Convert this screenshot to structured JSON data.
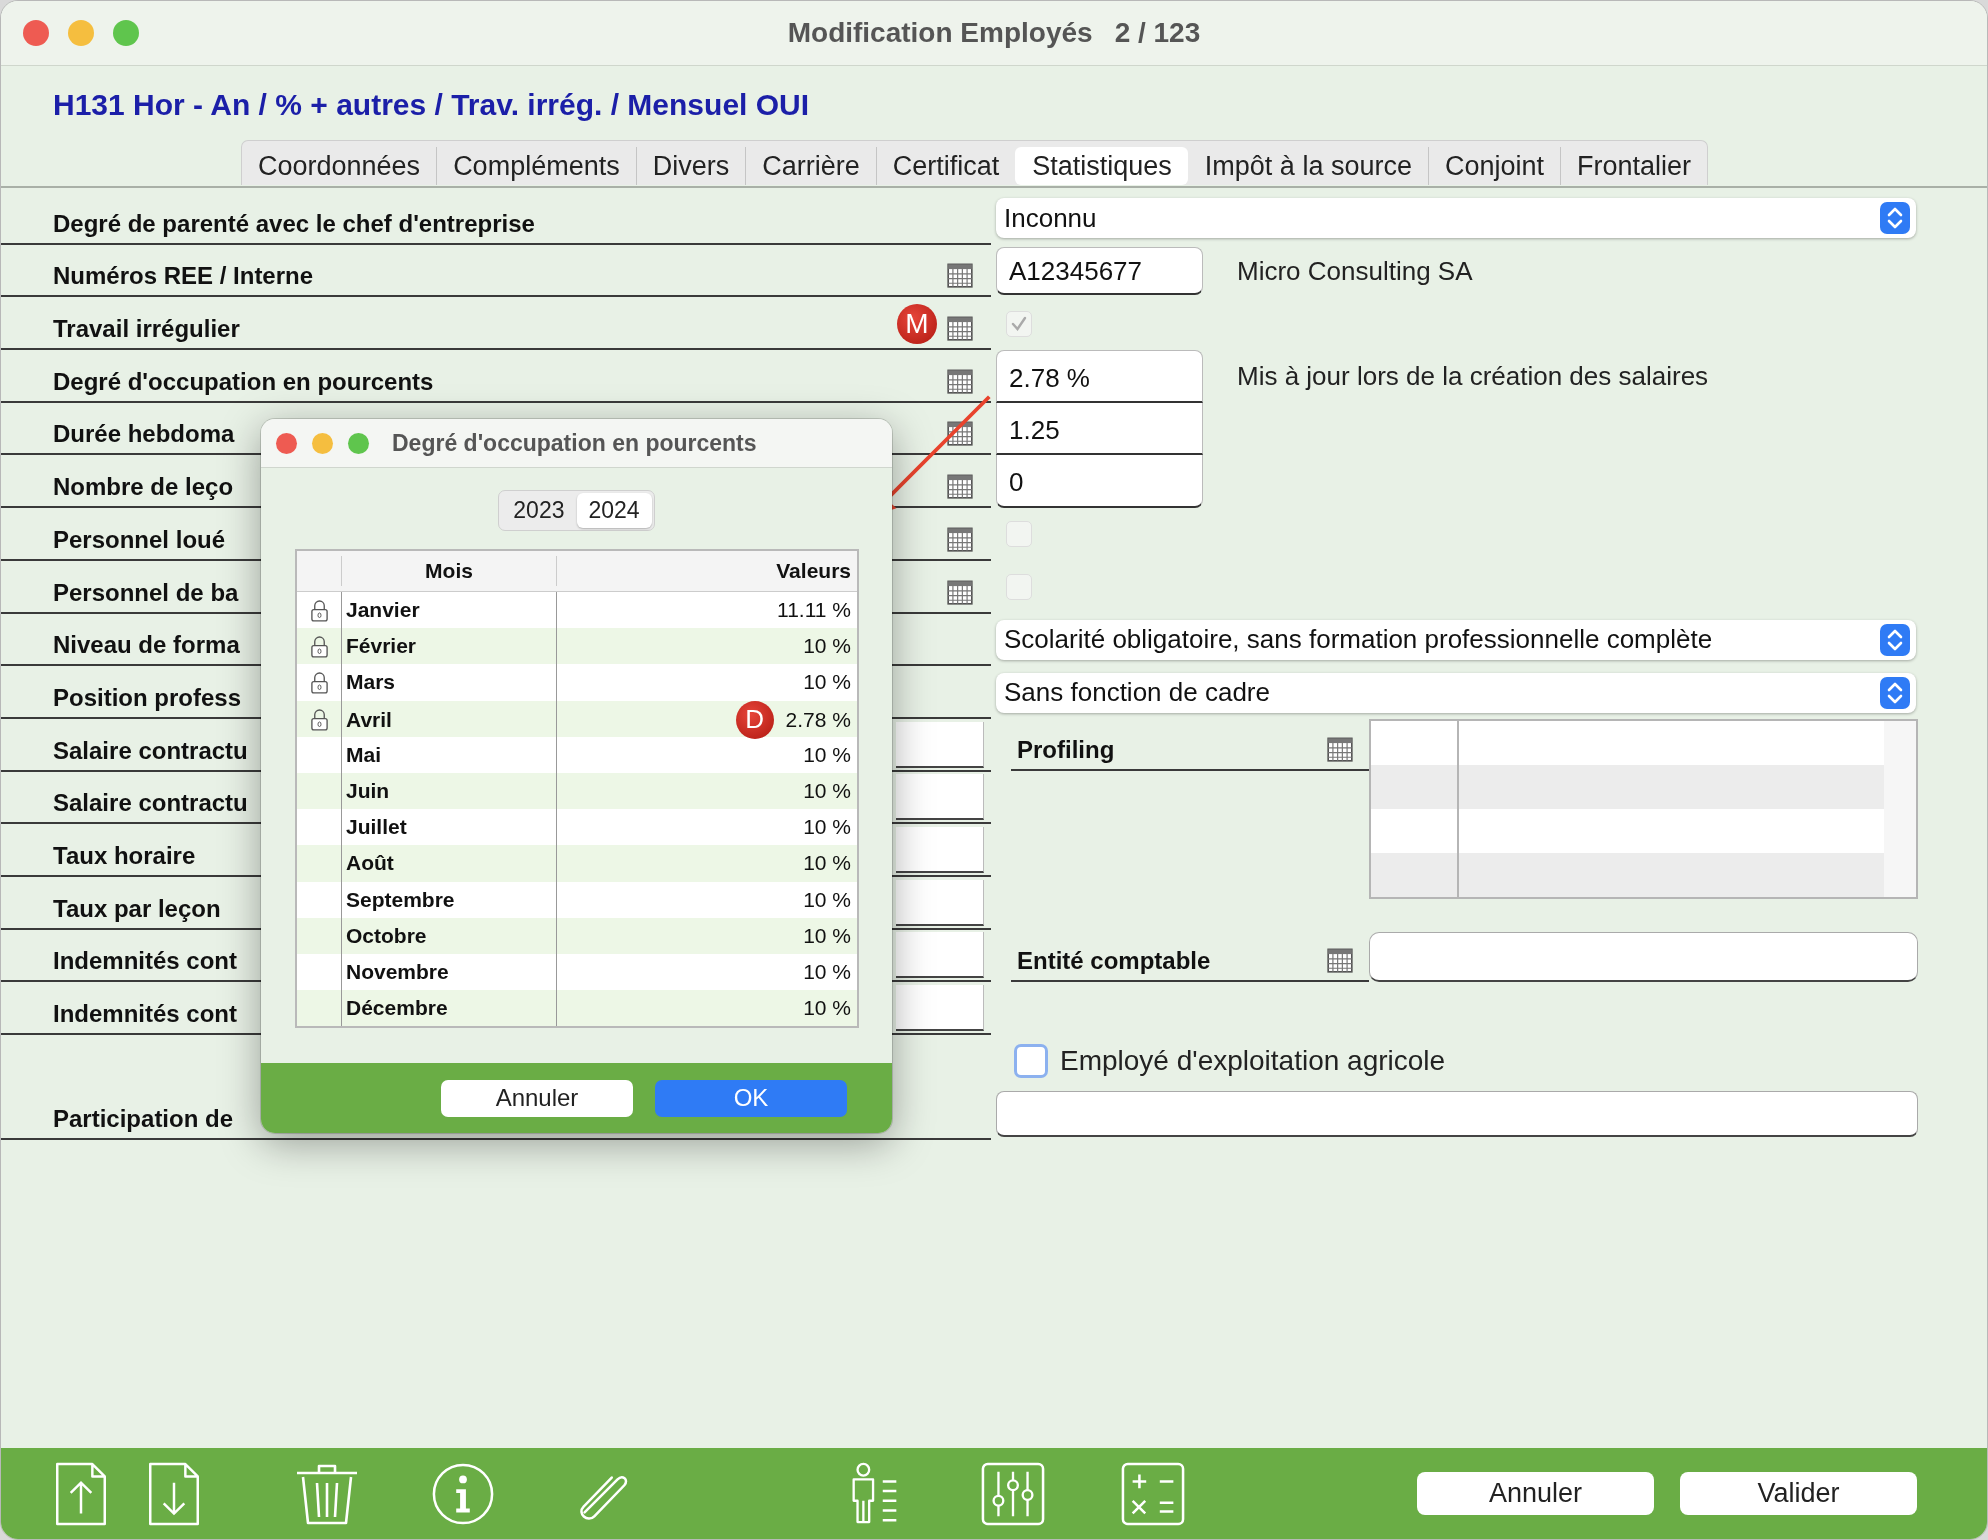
{
  "window": {
    "title": "Modification Employés",
    "record": "2 / 123"
  },
  "header": "H131 Hor - An / % + autres / Trav. irrég. / Mensuel OUI",
  "tabs": [
    {
      "label": "Coordonnées",
      "selected": false
    },
    {
      "label": "Compléments",
      "selected": false
    },
    {
      "label": "Divers",
      "selected": false
    },
    {
      "label": "Carrière",
      "selected": false
    },
    {
      "label": "Certificat",
      "selected": false
    },
    {
      "label": "Statistiques",
      "selected": true
    },
    {
      "label": "Impôt à la source",
      "selected": false
    },
    {
      "label": "Conjoint",
      "selected": false
    },
    {
      "label": "Frontalier",
      "selected": false
    }
  ],
  "form_rows": [
    {
      "label": "Degré de parenté avec le chef d'entreprise",
      "calendar": false,
      "control": {
        "kind": "dropdown",
        "value": "Inconnu"
      }
    },
    {
      "label": "Numéros REE / Interne",
      "calendar": true,
      "control": {
        "kind": "field",
        "value": "A12345677",
        "note": "Micro Consulting SA"
      }
    },
    {
      "label": "Travail irrégulier",
      "calendar": true,
      "badge": "M",
      "control": {
        "kind": "checkbox",
        "checked": true
      }
    },
    {
      "label": "Degré d'occupation en pourcents",
      "calendar": true,
      "control": {
        "kind": "stacked_field",
        "value": "2.78 %",
        "note": "Mis à jour lors de la création des salaires"
      }
    },
    {
      "label": "Durée hebdoma",
      "calendar": true,
      "control": {
        "kind": "stacked_field",
        "value": "1.25"
      }
    },
    {
      "label": "Nombre de leço",
      "calendar": true,
      "control": {
        "kind": "stacked_field",
        "value": "0"
      }
    },
    {
      "label": "Personnel loué",
      "calendar": true,
      "control": {
        "kind": "checkbox",
        "checked": false
      }
    },
    {
      "label": "Personnel de ba",
      "calendar": true,
      "control": {
        "kind": "checkbox",
        "checked": false
      }
    },
    {
      "label": "Niveau de forma",
      "calendar": false,
      "control": {
        "kind": "dropdown",
        "value": "Scolarité obligatoire, sans formation professionnelle complète"
      }
    },
    {
      "label": "Position profess",
      "calendar": false,
      "control": {
        "kind": "dropdown",
        "value": "Sans fonction de cadre"
      }
    },
    {
      "label": "Salaire contractu",
      "calendar": false,
      "side_field": true
    },
    {
      "label": "Salaire contractu",
      "calendar": false,
      "side_field": true
    },
    {
      "label": "Taux horaire",
      "calendar": false,
      "side_field": true
    },
    {
      "label": "Taux par leçon",
      "calendar": false,
      "side_field": true
    },
    {
      "label": "Indemnités cont",
      "calendar": false,
      "side_field": true
    },
    {
      "label": "Indemnités cont",
      "calendar": false,
      "side_field": true
    },
    {
      "label": "Participation de",
      "calendar": false,
      "control": {
        "kind": "wide_field"
      }
    }
  ],
  "profiling": {
    "label": "Profiling"
  },
  "accounting_entity": {
    "label": "Entité comptable"
  },
  "farm_employee": {
    "label": "Employé d'exploitation agricole",
    "checked": false
  },
  "dialog": {
    "title": "Degré d'occupation en pourcents",
    "years": [
      {
        "label": "2023",
        "selected": false
      },
      {
        "label": "2024",
        "selected": true
      }
    ],
    "columns": [
      "Mois",
      "Valeurs"
    ],
    "rows": [
      {
        "month": "Janvier",
        "value": "11.11 %",
        "locked": true
      },
      {
        "month": "Février",
        "value": "10 %",
        "locked": true
      },
      {
        "month": "Mars",
        "value": "10 %",
        "locked": true
      },
      {
        "month": "Avril",
        "value": "2.78 %",
        "locked": true,
        "badge": "D"
      },
      {
        "month": "Mai",
        "value": "10 %",
        "locked": false
      },
      {
        "month": "Juin",
        "value": "10 %",
        "locked": false
      },
      {
        "month": "Juillet",
        "value": "10 %",
        "locked": false
      },
      {
        "month": "Août",
        "value": "10 %",
        "locked": false
      },
      {
        "month": "Septembre",
        "value": "10 %",
        "locked": false
      },
      {
        "month": "Octobre",
        "value": "10 %",
        "locked": false
      },
      {
        "month": "Novembre",
        "value": "10 %",
        "locked": false
      },
      {
        "month": "Décembre",
        "value": "10 %",
        "locked": false
      }
    ],
    "buttons": [
      {
        "label": "Annuler",
        "kind": "cancel"
      },
      {
        "label": "OK",
        "kind": "default"
      }
    ]
  },
  "toolbar_buttons": [
    "Annuler",
    "Valider"
  ]
}
